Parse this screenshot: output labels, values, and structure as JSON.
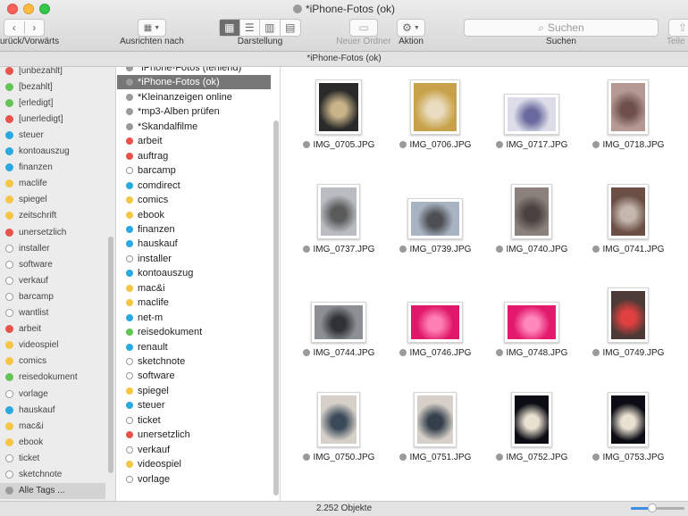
{
  "window": {
    "title": "*iPhone-Fotos (ok)",
    "path_title": "*iPhone-Fotos (ok)"
  },
  "toolbar": {
    "back_forward_label": "urück/Vorwärts",
    "arrange_label": "Ausrichten nach",
    "view_label": "Darstellung",
    "new_folder_label": "Neuer Ordner",
    "action_label": "Aktion",
    "search_placeholder": "Suchen",
    "search_label": "Suchen",
    "share_label": "Teile"
  },
  "sidebar": {
    "items": [
      {
        "label": "[unbezahlt]",
        "color": "#e8524a"
      },
      {
        "label": "[bezahlt]",
        "color": "#62c454"
      },
      {
        "label": "[erledigt]",
        "color": "#62c454"
      },
      {
        "label": "[unerledigt]",
        "color": "#e8524a"
      },
      {
        "label": "steuer",
        "color": "#29a9e0"
      },
      {
        "label": "kontoauszug",
        "color": "#29a9e0"
      },
      {
        "label": "finanzen",
        "color": "#29a9e0"
      },
      {
        "label": "maclife",
        "color": "#f5c543"
      },
      {
        "label": "spiegel",
        "color": "#f5c543"
      },
      {
        "label": "zeitschrift",
        "color": "#f5c543"
      },
      {
        "label": "unersetzlich",
        "color": "#e8524a"
      },
      {
        "label": "installer",
        "color": "hollow"
      },
      {
        "label": "software",
        "color": "hollow"
      },
      {
        "label": "verkauf",
        "color": "hollow"
      },
      {
        "label": "barcamp",
        "color": "hollow"
      },
      {
        "label": "wantlist",
        "color": "hollow"
      },
      {
        "label": "arbeit",
        "color": "#e8524a"
      },
      {
        "label": "videospiel",
        "color": "#f5c543"
      },
      {
        "label": "comics",
        "color": "#f5c543"
      },
      {
        "label": "reisedokument",
        "color": "#62c454"
      },
      {
        "label": "vorlage",
        "color": "hollow"
      },
      {
        "label": "hauskauf",
        "color": "#29a9e0"
      },
      {
        "label": "mac&i",
        "color": "#f5c543"
      },
      {
        "label": "ebook",
        "color": "#f5c543"
      },
      {
        "label": "ticket",
        "color": "hollow"
      },
      {
        "label": "sketchnote",
        "color": "hollow"
      },
      {
        "label": "Alle Tags ...",
        "color": "#9a9a9a"
      }
    ]
  },
  "middle": {
    "items": [
      {
        "label": "*iPhone-Fotos (fehlend)",
        "color": "#9a9a9a"
      },
      {
        "label": "*iPhone-Fotos (ok)",
        "color": "#9a9a9a"
      },
      {
        "label": "*Kleinanzeigen online",
        "color": "#9a9a9a"
      },
      {
        "label": "*mp3-Alben prüfen",
        "color": "#9a9a9a"
      },
      {
        "label": "*Skandalfilme",
        "color": "#9a9a9a"
      },
      {
        "label": "arbeit",
        "color": "#e8524a"
      },
      {
        "label": "auftrag",
        "color": "#e8524a"
      },
      {
        "label": "barcamp",
        "color": "hollow"
      },
      {
        "label": "comdirect",
        "color": "#29a9e0"
      },
      {
        "label": "comics",
        "color": "#f5c543"
      },
      {
        "label": "ebook",
        "color": "#f5c543"
      },
      {
        "label": "finanzen",
        "color": "#29a9e0"
      },
      {
        "label": "hauskauf",
        "color": "#29a9e0"
      },
      {
        "label": "installer",
        "color": "hollow"
      },
      {
        "label": "kontoauszug",
        "color": "#29a9e0"
      },
      {
        "label": "mac&i",
        "color": "#f5c543"
      },
      {
        "label": "maclife",
        "color": "#f5c543"
      },
      {
        "label": "net-m",
        "color": "#29a9e0"
      },
      {
        "label": "reisedokument",
        "color": "#62c454"
      },
      {
        "label": "renault",
        "color": "#29a9e0"
      },
      {
        "label": "sketchnote",
        "color": "hollow"
      },
      {
        "label": "software",
        "color": "hollow"
      },
      {
        "label": "spiegel",
        "color": "#f5c543"
      },
      {
        "label": "steuer",
        "color": "#29a9e0"
      },
      {
        "label": "ticket",
        "color": "hollow"
      },
      {
        "label": "unersetzlich",
        "color": "#e8524a"
      },
      {
        "label": "verkauf",
        "color": "hollow"
      },
      {
        "label": "videospiel",
        "color": "#f5c543"
      },
      {
        "label": "vorlage",
        "color": "hollow"
      }
    ]
  },
  "files": [
    {
      "name": "IMG_0705.JPG",
      "bg": "#2a2a2a",
      "fg": "#c9b489"
    },
    {
      "name": "IMG_0706.JPG",
      "bg": "#c8a24a",
      "fg": "#e9dcc0"
    },
    {
      "name": "IMG_0717.JPG",
      "bg": "#dcdde8",
      "fg": "#6a6aa0"
    },
    {
      "name": "IMG_0718.JPG",
      "bg": "#b49a92",
      "fg": "#6e4f4a"
    },
    {
      "name": "IMG_0737.JPG",
      "bg": "#b9bcc0",
      "fg": "#5a5a5a"
    },
    {
      "name": "IMG_0739.JPG",
      "bg": "#a9b4c2",
      "fg": "#4c4f53"
    },
    {
      "name": "IMG_0740.JPG",
      "bg": "#8a817c",
      "fg": "#4a4240"
    },
    {
      "name": "IMG_0741.JPG",
      "bg": "#6b4f45",
      "fg": "#c6b7ae"
    },
    {
      "name": "IMG_0744.JPG",
      "bg": "#8c8f94",
      "fg": "#2f3236"
    },
    {
      "name": "IMG_0746.JPG",
      "bg": "#e0186a",
      "fg": "#ff7fb2"
    },
    {
      "name": "IMG_0748.JPG",
      "bg": "#e3196c",
      "fg": "#ff88bb"
    },
    {
      "name": "IMG_0749.JPG",
      "bg": "#4b3a35",
      "fg": "#e04040"
    },
    {
      "name": "IMG_0750.JPG",
      "bg": "#d7d0c8",
      "fg": "#3a4a5a"
    },
    {
      "name": "IMG_0751.JPG",
      "bg": "#d7d0c8",
      "fg": "#34404c"
    },
    {
      "name": "IMG_0752.JPG",
      "bg": "#0c0c14",
      "fg": "#e8e0d0"
    },
    {
      "name": "IMG_0753.JPG",
      "bg": "#0c0c14",
      "fg": "#e8e0d0"
    }
  ],
  "status": {
    "count": "2.252 Objekte",
    "zoom_level": 0.4
  },
  "colors": {
    "accent": "#3b8ee0",
    "selection": "#777777"
  }
}
